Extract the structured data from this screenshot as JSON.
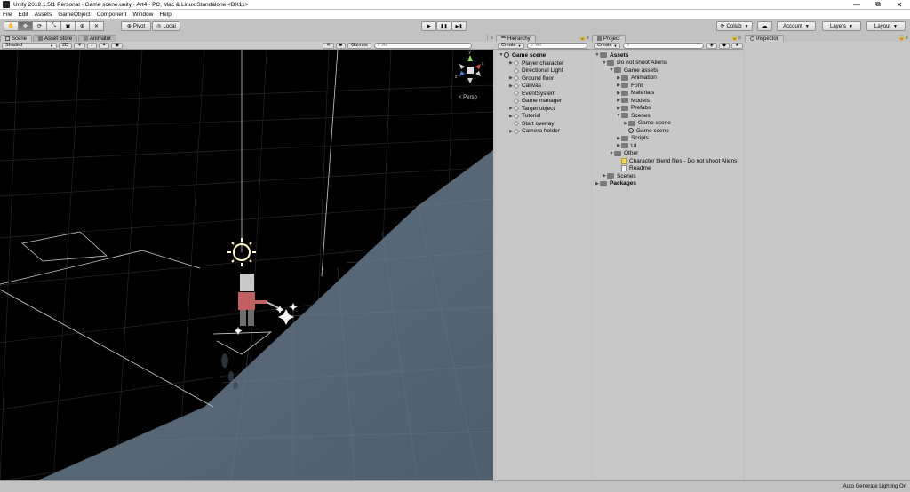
{
  "window": {
    "title": "Unity 2019.1.5f1 Personal - Game scene.unity - Art4 - PC, Mac & Linux Standalone <DX11>",
    "min_glyph": "—",
    "max_glyph": "⧉",
    "close_glyph": "✕"
  },
  "menu": [
    "File",
    "Edit",
    "Assets",
    "GameObject",
    "Component",
    "Window",
    "Help"
  ],
  "toolbar": {
    "pivot_label": "Pivot",
    "local_label": "Local",
    "play_glyph": "▶",
    "pause_glyph": "❚❚",
    "step_glyph": "▶❚",
    "collab_label": "Collab",
    "cloud_glyph": "☁",
    "account_label": "Account",
    "layers_label": "Layers",
    "layout_label": "Layout"
  },
  "scene_panel": {
    "tabs": [
      "Scene",
      "Asset Store",
      "Animator"
    ],
    "shading_mode": "Shaded",
    "mode_2d": "2D",
    "gizmos_label": "Gizmos",
    "search_placeholder": "All",
    "persp_label": "Persp",
    "axis_labels": {
      "y": "y",
      "x": "x",
      "z": "z"
    }
  },
  "hierarchy": {
    "tab": "Hierarchy",
    "create_label": "Create",
    "search_placeholder": "All",
    "scene_name": "Game scene",
    "items": [
      {
        "label": "Player character",
        "expandable": true
      },
      {
        "label": "Directional Light",
        "expandable": false
      },
      {
        "label": "Ground floor",
        "expandable": true
      },
      {
        "label": "Canvas",
        "expandable": true
      },
      {
        "label": "EventSystem",
        "expandable": false
      },
      {
        "label": "Game manager",
        "expandable": false
      },
      {
        "label": "Target object",
        "expandable": true
      },
      {
        "label": "Tutorial",
        "expandable": true
      },
      {
        "label": "Start overlay",
        "expandable": false
      },
      {
        "label": "Camera holder",
        "expandable": true
      }
    ]
  },
  "project": {
    "tab": "Project",
    "create_label": "Create",
    "search_placeholder": "",
    "tree": [
      {
        "label": "Assets",
        "depth": 0,
        "icon": "folder",
        "arrow": "▼",
        "bold": true
      },
      {
        "label": "Do not shoot Aliens",
        "depth": 1,
        "icon": "folder",
        "arrow": "▼",
        "bold": false
      },
      {
        "label": "Game assets",
        "depth": 2,
        "icon": "folder",
        "arrow": "▼",
        "bold": false
      },
      {
        "label": "Animation",
        "depth": 3,
        "icon": "folder",
        "arrow": "▶",
        "bold": false
      },
      {
        "label": "Font",
        "depth": 3,
        "icon": "folder",
        "arrow": "▶",
        "bold": false
      },
      {
        "label": "Materials",
        "depth": 3,
        "icon": "folder",
        "arrow": "▶",
        "bold": false
      },
      {
        "label": "Models",
        "depth": 3,
        "icon": "folder",
        "arrow": "▶",
        "bold": false
      },
      {
        "label": "Prefabs",
        "depth": 3,
        "icon": "folder",
        "arrow": "▶",
        "bold": false
      },
      {
        "label": "Scenes",
        "depth": 3,
        "icon": "folder",
        "arrow": "▼",
        "bold": false
      },
      {
        "label": "Game scene",
        "depth": 4,
        "icon": "folder",
        "arrow": "▶",
        "bold": false
      },
      {
        "label": "Game scene",
        "depth": 4,
        "icon": "scene",
        "arrow": "",
        "bold": false
      },
      {
        "label": "Scripts",
        "depth": 3,
        "icon": "folder",
        "arrow": "▶",
        "bold": false
      },
      {
        "label": "UI",
        "depth": 3,
        "icon": "folder",
        "arrow": "▶",
        "bold": false
      },
      {
        "label": "Other",
        "depth": 2,
        "icon": "folder",
        "arrow": "▼",
        "bold": false
      },
      {
        "label": "Character blend files - Do not shoot Aliens",
        "depth": 3,
        "icon": "warn",
        "arrow": "",
        "bold": false
      },
      {
        "label": "Readme",
        "depth": 3,
        "icon": "file",
        "arrow": "",
        "bold": false
      },
      {
        "label": "Scenes",
        "depth": 1,
        "icon": "folder",
        "arrow": "▶",
        "bold": false
      },
      {
        "label": "Packages",
        "depth": 0,
        "icon": "folder",
        "arrow": "▶",
        "bold": true
      }
    ]
  },
  "inspector": {
    "tab": "Inspector"
  },
  "status": {
    "text": "Auto Generate Lighting On"
  },
  "colors": {
    "editor_bg": "#c2c2c2",
    "scene_bg": "#000000",
    "ground": "#5e6e7b",
    "gizmo_axis_y": "#8ee04a",
    "gizmo_axis_x": "#e04a4a",
    "gizmo_axis_z": "#4a7ae0"
  }
}
